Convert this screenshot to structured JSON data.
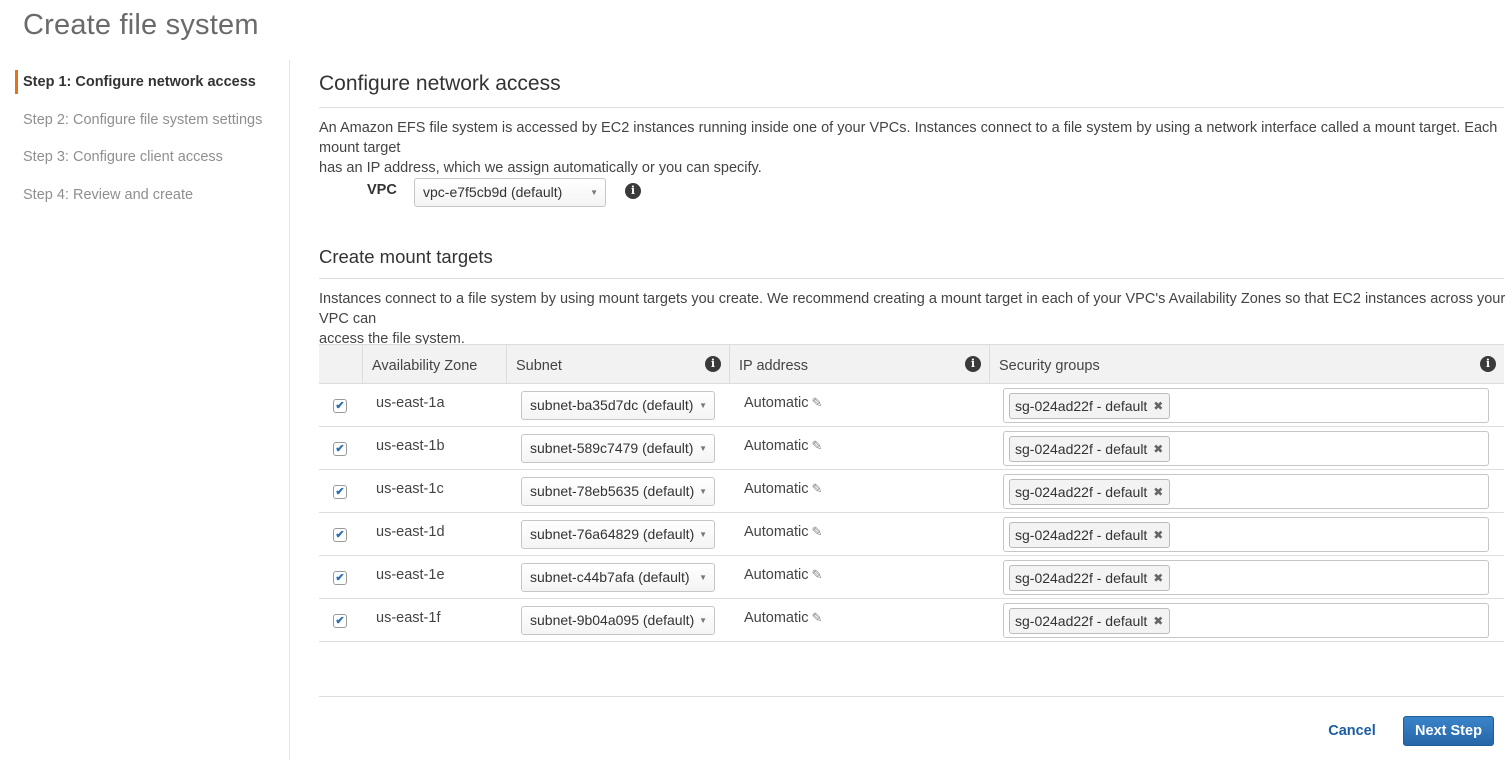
{
  "page_title": "Create file system",
  "sidebar": {
    "steps": [
      {
        "label": "Step 1: Configure network access",
        "active": true
      },
      {
        "label": "Step 2: Configure file system settings",
        "active": false
      },
      {
        "label": "Step 3: Configure client access",
        "active": false
      },
      {
        "label": "Step 4: Review and create",
        "active": false
      }
    ]
  },
  "network": {
    "title": "Configure network access",
    "description_line1": "An Amazon EFS file system is accessed by EC2 instances running inside one of your VPCs. Instances connect to a file system by using a network interface called a mount target. Each mount target",
    "description_line2": "has an IP address, which we assign automatically or you can specify.",
    "vpc_label": "VPC",
    "vpc_value": "vpc-e7f5cb9d (default)"
  },
  "mount_targets": {
    "title": "Create mount targets",
    "description_line1": "Instances connect to a file system by using mount targets you create. We recommend creating a mount target in each of your VPC's Availability Zones so that EC2 instances across your VPC can",
    "description_line2": "access the file system.",
    "columns": {
      "az": "Availability Zone",
      "subnet": "Subnet",
      "ip": "IP address",
      "sg": "Security groups"
    },
    "rows": [
      {
        "checked": true,
        "az": "us-east-1a",
        "subnet": "subnet-ba35d7dc (default)",
        "ip": "Automatic",
        "sg": "sg-024ad22f - default"
      },
      {
        "checked": true,
        "az": "us-east-1b",
        "subnet": "subnet-589c7479 (default)",
        "ip": "Automatic",
        "sg": "sg-024ad22f - default"
      },
      {
        "checked": true,
        "az": "us-east-1c",
        "subnet": "subnet-78eb5635 (default)",
        "ip": "Automatic",
        "sg": "sg-024ad22f - default"
      },
      {
        "checked": true,
        "az": "us-east-1d",
        "subnet": "subnet-76a64829 (default)",
        "ip": "Automatic",
        "sg": "sg-024ad22f - default"
      },
      {
        "checked": true,
        "az": "us-east-1e",
        "subnet": "subnet-c44b7afa (default)",
        "ip": "Automatic",
        "sg": "sg-024ad22f - default"
      },
      {
        "checked": true,
        "az": "us-east-1f",
        "subnet": "subnet-9b04a095 (default)",
        "ip": "Automatic",
        "sg": "sg-024ad22f - default"
      }
    ]
  },
  "footer": {
    "cancel_label": "Cancel",
    "next_label": "Next Step"
  },
  "icons": {
    "info": "info-icon",
    "check": "check-icon",
    "pencil": "pencil-icon",
    "remove": "remove-icon",
    "caret": "caret-down-icon"
  },
  "colors": {
    "accent_step": "#e9711c",
    "primary_button": "#2f77bd",
    "link": "#1a5da6"
  }
}
